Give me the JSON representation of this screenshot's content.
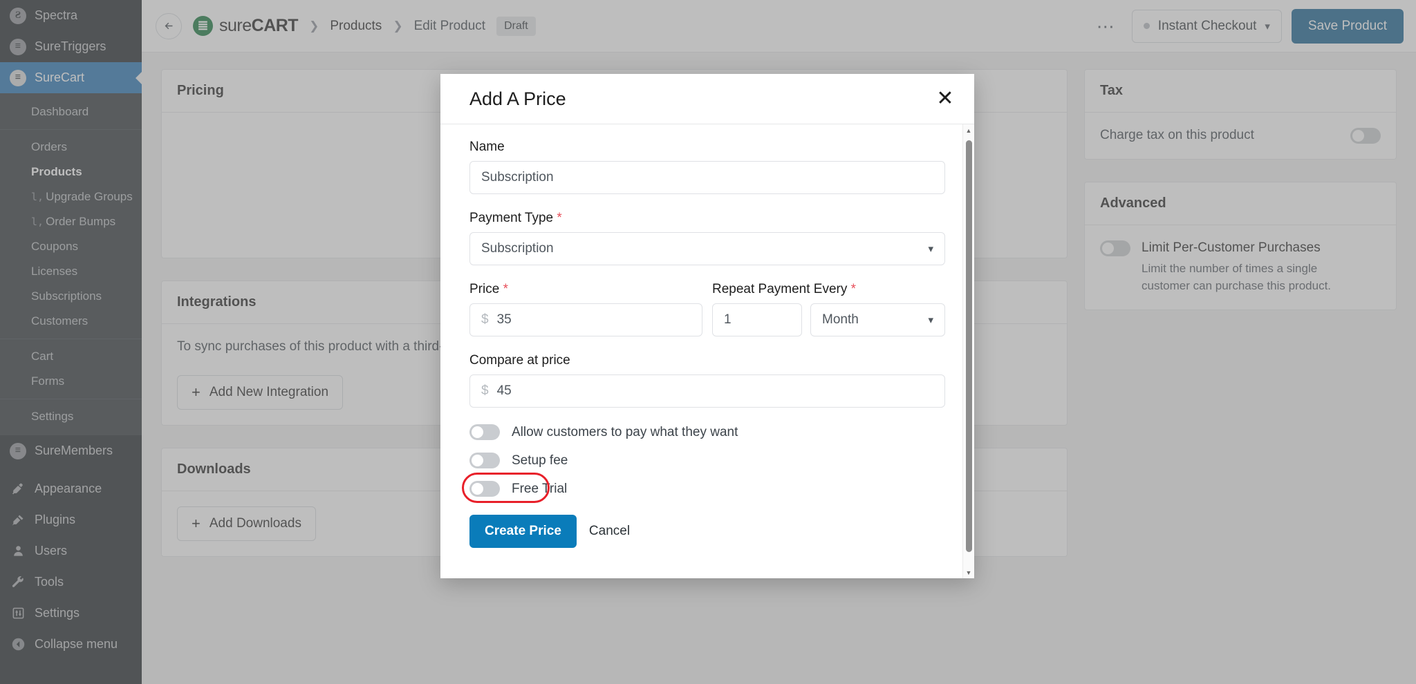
{
  "wp_sidebar": {
    "plugins": [
      {
        "label": "Spectra",
        "icon": "spectra-logo-icon",
        "glyph": "Ƨ"
      },
      {
        "label": "SureTriggers",
        "icon": "suretriggers-logo-icon",
        "glyph": "≣"
      },
      {
        "label": "SureCart",
        "icon": "surecart-logo-icon",
        "glyph": "≣",
        "active": true
      }
    ],
    "surecart_menu": {
      "dashboard": "Dashboard",
      "group_one": [
        {
          "label": "Orders"
        },
        {
          "label": "Products",
          "current": true
        },
        {
          "label": "Upgrade Groups",
          "broken_icon": "l,"
        },
        {
          "label": "Order Bumps",
          "broken_icon": "l,"
        },
        {
          "label": "Coupons"
        },
        {
          "label": "Licenses"
        },
        {
          "label": "Subscriptions"
        },
        {
          "label": "Customers"
        }
      ],
      "group_two": [
        {
          "label": "Cart"
        },
        {
          "label": "Forms"
        }
      ],
      "group_three": [
        {
          "label": "Settings"
        }
      ]
    },
    "suremembers": {
      "label": "SureMembers",
      "icon": "suremembers-logo-icon",
      "glyph": "≣"
    },
    "wp_core": [
      {
        "label": "Appearance",
        "icon": "paintbrush-icon",
        "glyph": "✎"
      },
      {
        "label": "Plugins",
        "icon": "plug-icon",
        "glyph": "⚡"
      },
      {
        "label": "Users",
        "icon": "user-icon",
        "glyph": "●"
      },
      {
        "label": "Tools",
        "icon": "wrench-icon",
        "glyph": "⚒"
      },
      {
        "label": "Settings",
        "icon": "sliders-icon",
        "glyph": "⚙"
      }
    ],
    "collapse": {
      "label": "Collapse menu",
      "icon": "chevron-left-circle-icon",
      "glyph": "◀"
    }
  },
  "topbar": {
    "back_icon": "arrow-left-icon",
    "brand": {
      "mark_glyph": "≣",
      "text_light": "sure",
      "text_bold": "CART"
    },
    "breadcrumb": [
      "Products",
      "Edit Product"
    ],
    "status_badge": "Draft",
    "more_icon": "ellipsis-icon",
    "checkout_select": {
      "value": "Instant Checkout",
      "chevron": "chevron-down-icon"
    },
    "save_label": "Save Product"
  },
  "main_cards": {
    "pricing_title": "Pricing",
    "integrations_title": "Integrations",
    "integrations_text": "To sync purchases of this product with a third-party service, add an integration.",
    "add_integration_label": "Add New Integration",
    "downloads_title": "Downloads",
    "add_downloads_label": "Add Downloads"
  },
  "side_cards": {
    "tax_title": "Tax",
    "tax_toggle_label": "Charge tax on this product",
    "advanced_title": "Advanced",
    "limit_title": "Limit Per-Customer Purchases",
    "limit_desc": "Limit the number of times a single customer can purchase this product."
  },
  "modal": {
    "title": "Add A Price",
    "close_icon": "close-icon",
    "name": {
      "label": "Name",
      "value": "Subscription",
      "placeholder": "Subscription"
    },
    "payment_type": {
      "label": "Payment Type",
      "required": "*",
      "value": "Subscription",
      "chevron": "chevron-down-icon"
    },
    "price": {
      "label": "Price",
      "required": "*",
      "currency": "$",
      "value": "35"
    },
    "repeat": {
      "label": "Repeat Payment Every",
      "required": "*",
      "count": "1",
      "unit": "Month",
      "chevron": "chevron-down-icon"
    },
    "compare_at": {
      "label": "Compare at price",
      "currency": "$",
      "value": "45"
    },
    "toggles": [
      {
        "label": "Allow customers to pay what they want",
        "on": false,
        "highlighted": false
      },
      {
        "label": "Setup fee",
        "on": false,
        "highlighted": false
      },
      {
        "label": "Free Trial",
        "on": false,
        "highlighted": true
      }
    ],
    "create_label": "Create Price",
    "cancel_label": "Cancel",
    "scrollbar": {
      "up_glyph": "▲",
      "down_glyph": "▼"
    }
  },
  "colors": {
    "wp_sidebar_bg": "#1d2327",
    "wp_active_blue": "#2271b1",
    "brand_green": "#12753a",
    "primary_blue": "#0a7cba",
    "save_blue": "#125f8e",
    "highlight_red": "#e8202a",
    "required_red": "#e8505b"
  }
}
